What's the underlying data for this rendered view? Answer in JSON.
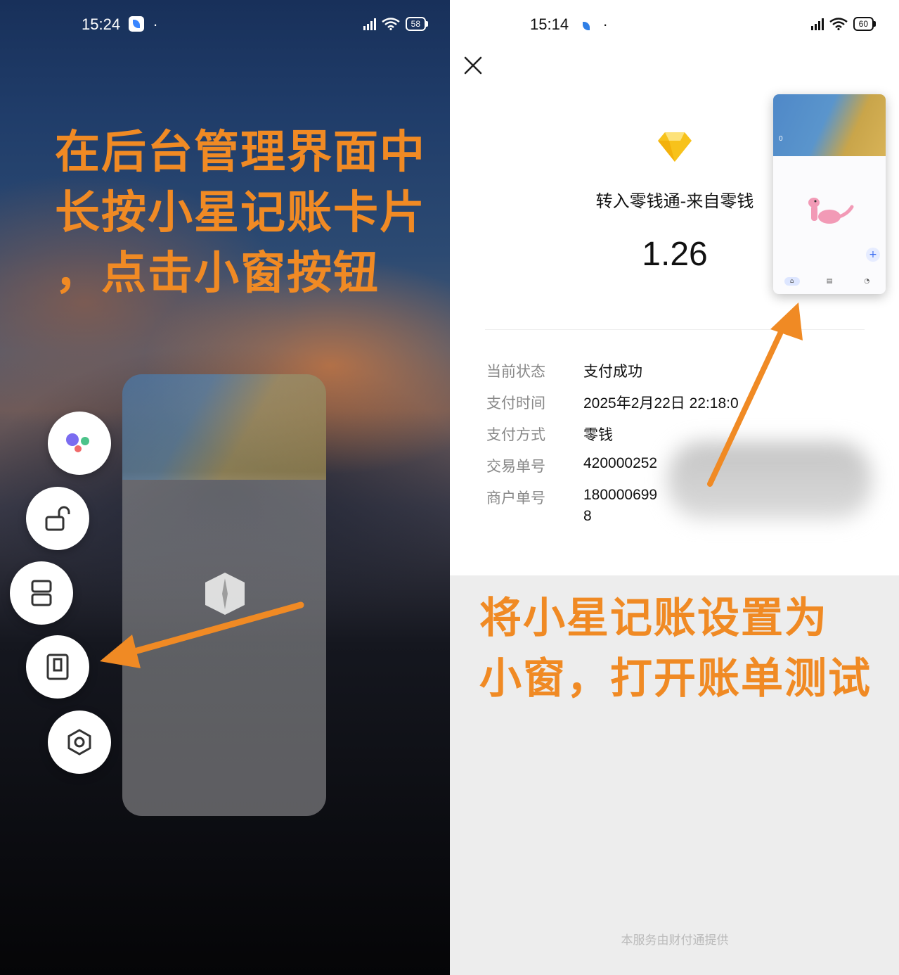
{
  "left": {
    "status": {
      "time": "15:24",
      "battery": "58"
    },
    "title_lines": [
      "在后台管理界面中",
      "长按小星记账卡片",
      "，点击小窗按钮"
    ],
    "side_buttons": [
      "assistant-icon",
      "unlock-icon",
      "split-screen-icon",
      "small-window-icon",
      "settings-icon"
    ]
  },
  "right": {
    "status": {
      "time": "15:14",
      "battery": "60"
    },
    "payment": {
      "title": "转入零钱通-来自零钱",
      "amount": "1.26",
      "rows": [
        {
          "key": "当前状态",
          "value": "支付成功"
        },
        {
          "key": "支付时间",
          "value": "2025年2月22日 22:18:0"
        },
        {
          "key": "支付方式",
          "value": "零钱"
        },
        {
          "key": "交易单号",
          "value": "420000252"
        },
        {
          "key": "商户单号",
          "value": "180000699",
          "value2": "8"
        }
      ],
      "footer": "本服务由财付通提供"
    },
    "mini_window": {
      "amount": "0"
    },
    "title_lines": [
      "将小星记账设置为",
      "小窗，打开账单测试"
    ]
  },
  "colors": {
    "accent": "#f08a24",
    "diamond": "#f7c21b"
  }
}
